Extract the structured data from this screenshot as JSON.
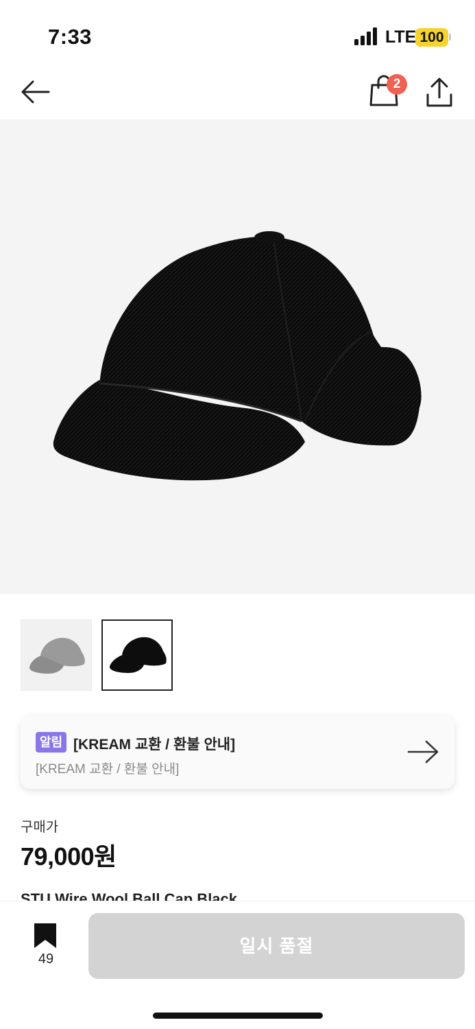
{
  "status_bar": {
    "time": "7:33",
    "network": "LTE",
    "battery": "100"
  },
  "nav": {
    "bag_count": "2"
  },
  "product": {
    "images": [
      {
        "color": "gray",
        "icon": "gray-cap-thumbnail"
      },
      {
        "color": "black",
        "icon": "black-cap-thumbnail",
        "selected": true
      }
    ],
    "main_image_icon": "black-wool-cap"
  },
  "notice": {
    "tag": "알림",
    "title": "[KREAM 교환 / 환불 안내]",
    "subtitle": "[KREAM 교환 / 환불 안내]"
  },
  "price": {
    "label": "구매가",
    "value": "79,000원"
  },
  "product_name_partial": "STU Wire Wool Ball Cap Black",
  "bottom_bar": {
    "bookmark_count": "49",
    "button_label": "일시 품절"
  },
  "colors": {
    "badge": "#ef6253",
    "notice_tag": "#8a76e8",
    "disabled_button": "#d3d3d3",
    "battery": "#f6d32d"
  }
}
